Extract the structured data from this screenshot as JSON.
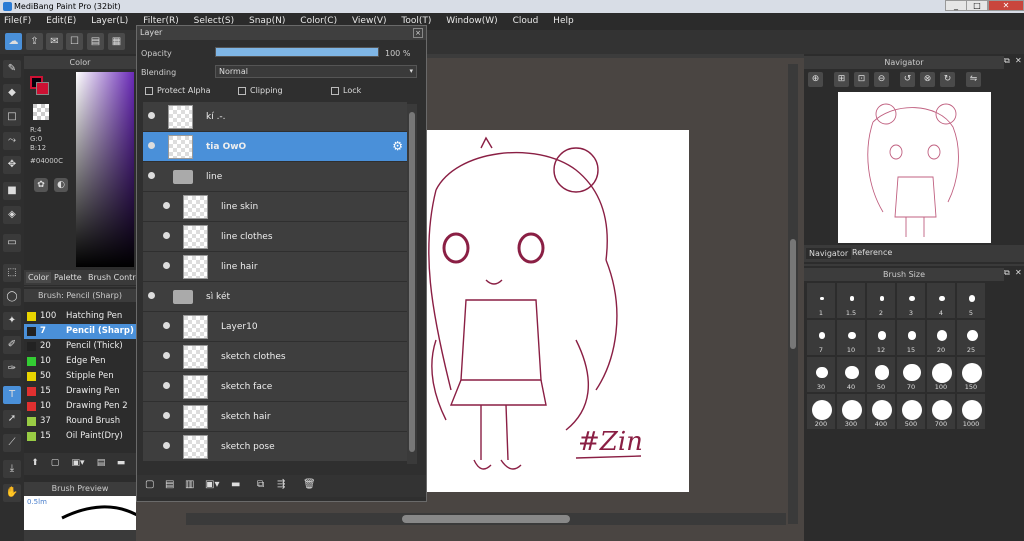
{
  "title": "MediBang Paint Pro (32bit)",
  "window_controls": [
    "_",
    "□",
    "✕"
  ],
  "menu": [
    "File(F)",
    "Edit(E)",
    "Layer(L)",
    "Filter(R)",
    "Select(S)",
    "Snap(N)",
    "Color(C)",
    "View(V)",
    "Tool(T)",
    "Window(W)",
    "Cloud",
    "Help"
  ],
  "color_panel": {
    "header": "Color",
    "r": "R:4",
    "g": "G:0",
    "b": "B:12",
    "hex": "#04000C",
    "tabs": [
      "Color",
      "Palette",
      "Brush Control"
    ]
  },
  "brush_panel": {
    "title": "Brush: Pencil (Sharp)",
    "items": [
      {
        "size": "100",
        "name": "Hatching Pen",
        "color": "#e8d400"
      },
      {
        "size": "7",
        "name": "Pencil (Sharp)",
        "color": "#222222"
      },
      {
        "size": "20",
        "name": "Pencil (Thick)",
        "color": "#222222"
      },
      {
        "size": "10",
        "name": "Edge Pen",
        "color": "#33cc33"
      },
      {
        "size": "50",
        "name": "Stipple Pen",
        "color": "#e8d400"
      },
      {
        "size": "15",
        "name": "Drawing Pen",
        "color": "#e03030"
      },
      {
        "size": "10",
        "name": "Drawing Pen 2",
        "color": "#e03030"
      },
      {
        "size": "37",
        "name": "Round Brush",
        "color": "#99cc44"
      },
      {
        "size": "15",
        "name": "Oil Paint(Dry)",
        "color": "#99cc44"
      }
    ],
    "preview_header": "Brush Preview",
    "preview_size": "0.5lm"
  },
  "layer_panel": {
    "title": "Layer",
    "opacity_label": "Opacity",
    "opacity_value": "100 %",
    "blending_label": "Blending",
    "blending_value": "Normal",
    "protect_alpha": "Protect Alpha",
    "clipping": "Clipping",
    "lock": "Lock",
    "layers": [
      {
        "name": "kí .-.",
        "selected": false,
        "indent": 0,
        "folder": false
      },
      {
        "name": "tia OwO",
        "selected": true,
        "indent": 0,
        "folder": false
      },
      {
        "name": "line",
        "selected": false,
        "indent": 0,
        "folder": true
      },
      {
        "name": "line skin",
        "selected": false,
        "indent": 1,
        "folder": false
      },
      {
        "name": "line clothes",
        "selected": false,
        "indent": 1,
        "folder": false
      },
      {
        "name": "line hair",
        "selected": false,
        "indent": 1,
        "folder": false
      },
      {
        "name": "sì két",
        "selected": false,
        "indent": 0,
        "folder": true
      },
      {
        "name": "Layer10",
        "selected": false,
        "indent": 1,
        "folder": false
      },
      {
        "name": "sketch clothes",
        "selected": false,
        "indent": 1,
        "folder": false
      },
      {
        "name": "sketch face",
        "selected": false,
        "indent": 1,
        "folder": false
      },
      {
        "name": "sketch hair",
        "selected": false,
        "indent": 1,
        "folder": false
      },
      {
        "name": "sketch pose",
        "selected": false,
        "indent": 1,
        "folder": false
      }
    ]
  },
  "navigator": {
    "title": "Navigator",
    "tabs": [
      "Navigator",
      "Reference"
    ]
  },
  "brush_size": {
    "title": "Brush Size",
    "sizes": [
      "1",
      "1.5",
      "2",
      "3",
      "4",
      "5",
      "7",
      "10",
      "12",
      "15",
      "20",
      "25",
      "30",
      "40",
      "50",
      "70",
      "100",
      "150",
      "200",
      "300",
      "400",
      "500",
      "700",
      "1000"
    ]
  },
  "artwork_signature": "#Zin",
  "colors": {
    "accent": "#4a90d9",
    "line_art": "#8a1f44"
  }
}
